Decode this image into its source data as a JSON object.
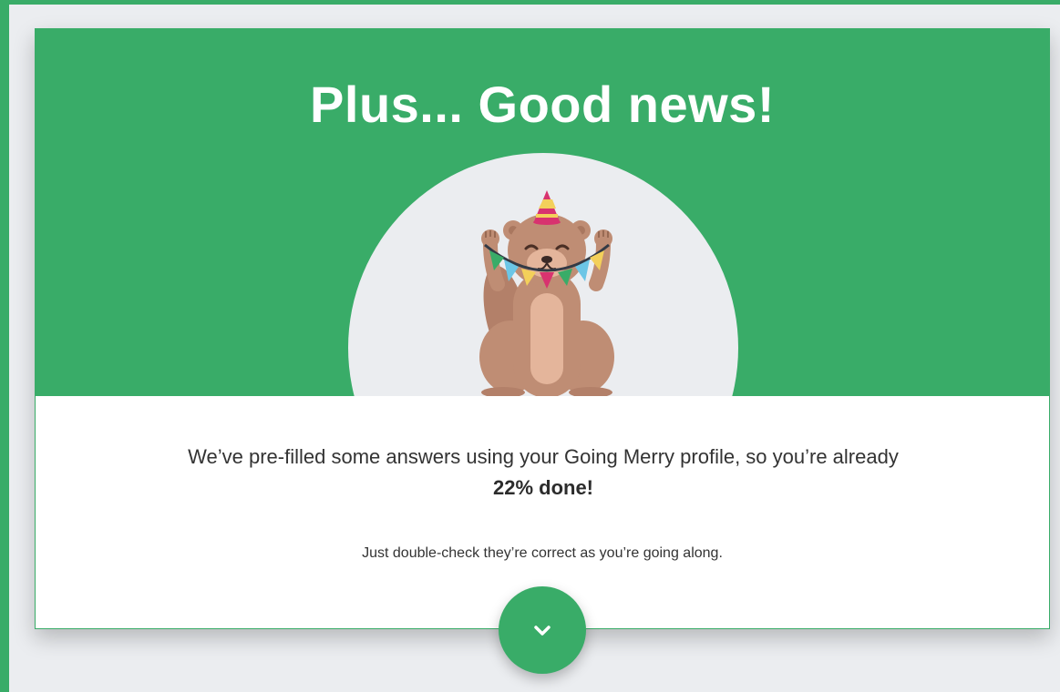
{
  "card": {
    "title": "Plus... Good news!",
    "message_prefix": "We’ve pre-filled some answers using your Going Merry profile, so you’re already",
    "message_highlight": "22% done!",
    "sub_message": "Just double-check they’re correct as you’re going along."
  },
  "progress": {
    "percent_done": 22
  },
  "mascot": {
    "icon": "party-bear-icon"
  },
  "next_button": {
    "icon": "chevron-down-icon"
  },
  "colors": {
    "accent": "#39ac68",
    "background": "#ebedf0",
    "text": "#333333",
    "bunting": [
      "#39ac68",
      "#6cc6e6",
      "#f3d05a",
      "#d8336f"
    ]
  }
}
